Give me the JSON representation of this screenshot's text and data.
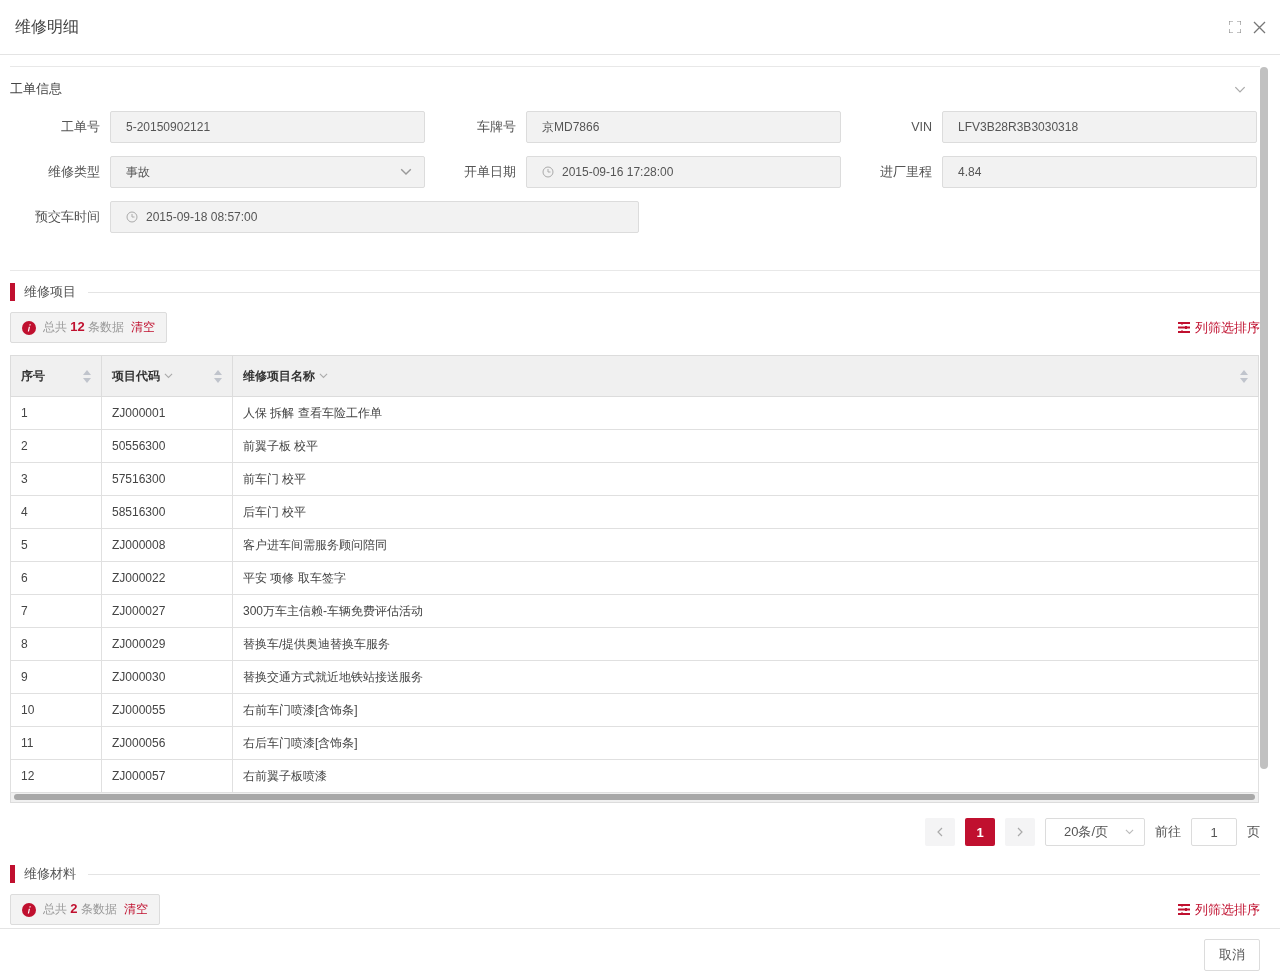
{
  "dialog": {
    "title": "维修明细"
  },
  "order_info": {
    "title": "工单信息",
    "expanded": true,
    "fields": [
      {
        "label": "工单号",
        "kind": "text",
        "value": "5-20150902121"
      },
      {
        "label": "车牌号",
        "kind": "text",
        "value": "京MD7866"
      },
      {
        "label": "VIN",
        "kind": "text",
        "value": "LFV3B28R3B3030318"
      },
      {
        "label": "维修类型",
        "kind": "select",
        "value": "事故"
      },
      {
        "label": "开单日期",
        "kind": "date",
        "value": "2015-09-16 17:28:00"
      },
      {
        "label": "进厂里程",
        "kind": "text",
        "value": "4.84"
      },
      {
        "label": "预交车时间",
        "kind": "date",
        "value": "2015-09-18 08:57:00"
      }
    ]
  },
  "repair_items": {
    "title": "维修项目",
    "count_text": "总共 **12** 条数据",
    "clear_link": "清空",
    "column_settings": "列筛选排序",
    "table": {
      "columns": [
        {
          "label": "序号",
          "filter": false,
          "sortable": true
        },
        {
          "label": "项目代码",
          "filter": true,
          "sortable": true
        },
        {
          "label": "维修项目名称",
          "filter": true,
          "sortable": true
        }
      ],
      "rows": [
        [
          "1",
          "ZJ000001",
          "人保 拆解 查看车险工作单"
        ],
        [
          "2",
          "50556300",
          "前翼子板 校平"
        ],
        [
          "3",
          "57516300",
          "前车门 校平"
        ],
        [
          "4",
          "58516300",
          "后车门 校平"
        ],
        [
          "5",
          "ZJ000008",
          "客户进车间需服务顾问陪同"
        ],
        [
          "6",
          "ZJ000022",
          "平安 项修 取车签字"
        ],
        [
          "7",
          "ZJ000027",
          "300万车主信赖-车辆免费评估活动"
        ],
        [
          "8",
          "ZJ000029",
          "替换车/提供奥迪替换车服务"
        ],
        [
          "9",
          "ZJ000030",
          "替换交通方式就近地铁站接送服务"
        ],
        [
          "10",
          "ZJ000055",
          "右前车门喷漆[含饰条]"
        ],
        [
          "11",
          "ZJ000056",
          "右后车门喷漆[含饰条]"
        ],
        [
          "12",
          "ZJ000057",
          "右前翼子板喷漆"
        ]
      ]
    },
    "pagination": {
      "pages": [
        {
          "label": "1",
          "selected": true
        }
      ],
      "page_size": "20条/页",
      "goto_label": "前往",
      "goto_value": "1",
      "page_unit": "页"
    }
  },
  "repair_materials": {
    "title": "维修材料",
    "count_text": "总共 **2** 条数据",
    "clear_link": "清空",
    "column_settings": "列筛选排序"
  },
  "footer": {
    "buttons": [
      "取消"
    ]
  }
}
